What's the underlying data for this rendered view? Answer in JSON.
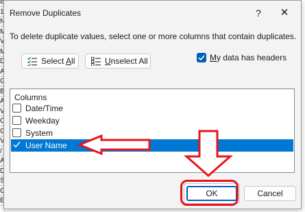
{
  "dialog": {
    "title": "Remove Duplicates",
    "help_glyph": "?",
    "close_glyph": "✕",
    "instructions": "To delete duplicate values, select one or more columns that contain duplicates."
  },
  "toolbar": {
    "select_all_label": "Select All",
    "select_all_mnemonic": "A",
    "unselect_all_label": "Unselect All",
    "unselect_all_mnemonic": "U"
  },
  "headers_option": {
    "label": "My data has headers",
    "checked": true
  },
  "columns": {
    "header": "Columns",
    "items": [
      {
        "label": "Date/Time",
        "checked": false,
        "selected": false
      },
      {
        "label": "Weekday",
        "checked": false,
        "selected": false
      },
      {
        "label": "System",
        "checked": false,
        "selected": false
      },
      {
        "label": "User Name",
        "checked": true,
        "selected": true
      }
    ]
  },
  "buttons": {
    "ok_label": "OK",
    "cancel_label": "Cancel"
  },
  "sheet_fragments": [
    "BORO",
    "1",
    "N",
    "M",
    "V",
    "M",
    "D",
    "A",
    "G",
    "B",
    "A",
    "V",
    "C",
    "G",
    "V",
    "/",
    "A",
    "D",
    "S",
    "G",
    "ERMEK"
  ],
  "colors": {
    "accent": "#005fb8",
    "selection": "#0078d4",
    "annotation_red": "#e8141c",
    "dialog_bg": "#f3f3f3"
  }
}
